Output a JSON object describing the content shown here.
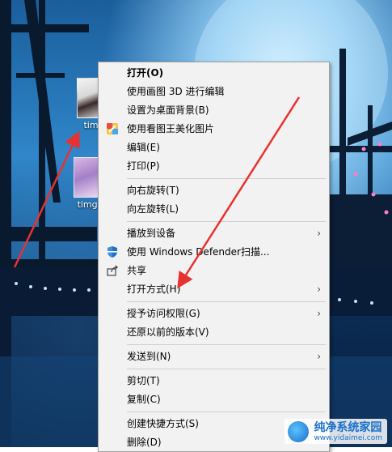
{
  "desktop": {
    "icons": [
      {
        "label": "timg"
      },
      {
        "label": "timg ("
      }
    ]
  },
  "menu": {
    "items": [
      {
        "label": "打开(O)"
      },
      {
        "label": "使用画图 3D 进行编辑"
      },
      {
        "label": "设置为桌面背景(B)"
      },
      {
        "label": "使用看图王美化图片"
      },
      {
        "label": "编辑(E)"
      },
      {
        "label": "打印(P)"
      },
      {
        "label": "向右旋转(T)"
      },
      {
        "label": "向左旋转(L)"
      },
      {
        "label": "播放到设备"
      },
      {
        "label": "使用 Windows Defender扫描..."
      },
      {
        "label": "共享"
      },
      {
        "label": "打开方式(H)"
      },
      {
        "label": "授予访问权限(G)"
      },
      {
        "label": "还原以前的版本(V)"
      },
      {
        "label": "发送到(N)"
      },
      {
        "label": "剪切(T)"
      },
      {
        "label": "复制(C)"
      },
      {
        "label": "创建快捷方式(S)"
      },
      {
        "label": "删除(D)"
      }
    ],
    "submenu_arrow": "›"
  },
  "watermark": {
    "title": "纯净系统家园",
    "url": "www.yidaimei.com"
  },
  "colors": {
    "annotation_arrow": "#e8322f",
    "menu_bg": "#f2f2f2"
  },
  "icons": [
    "paint-app-icon",
    "shield-icon",
    "share-icon",
    "chevron-right-icon"
  ]
}
